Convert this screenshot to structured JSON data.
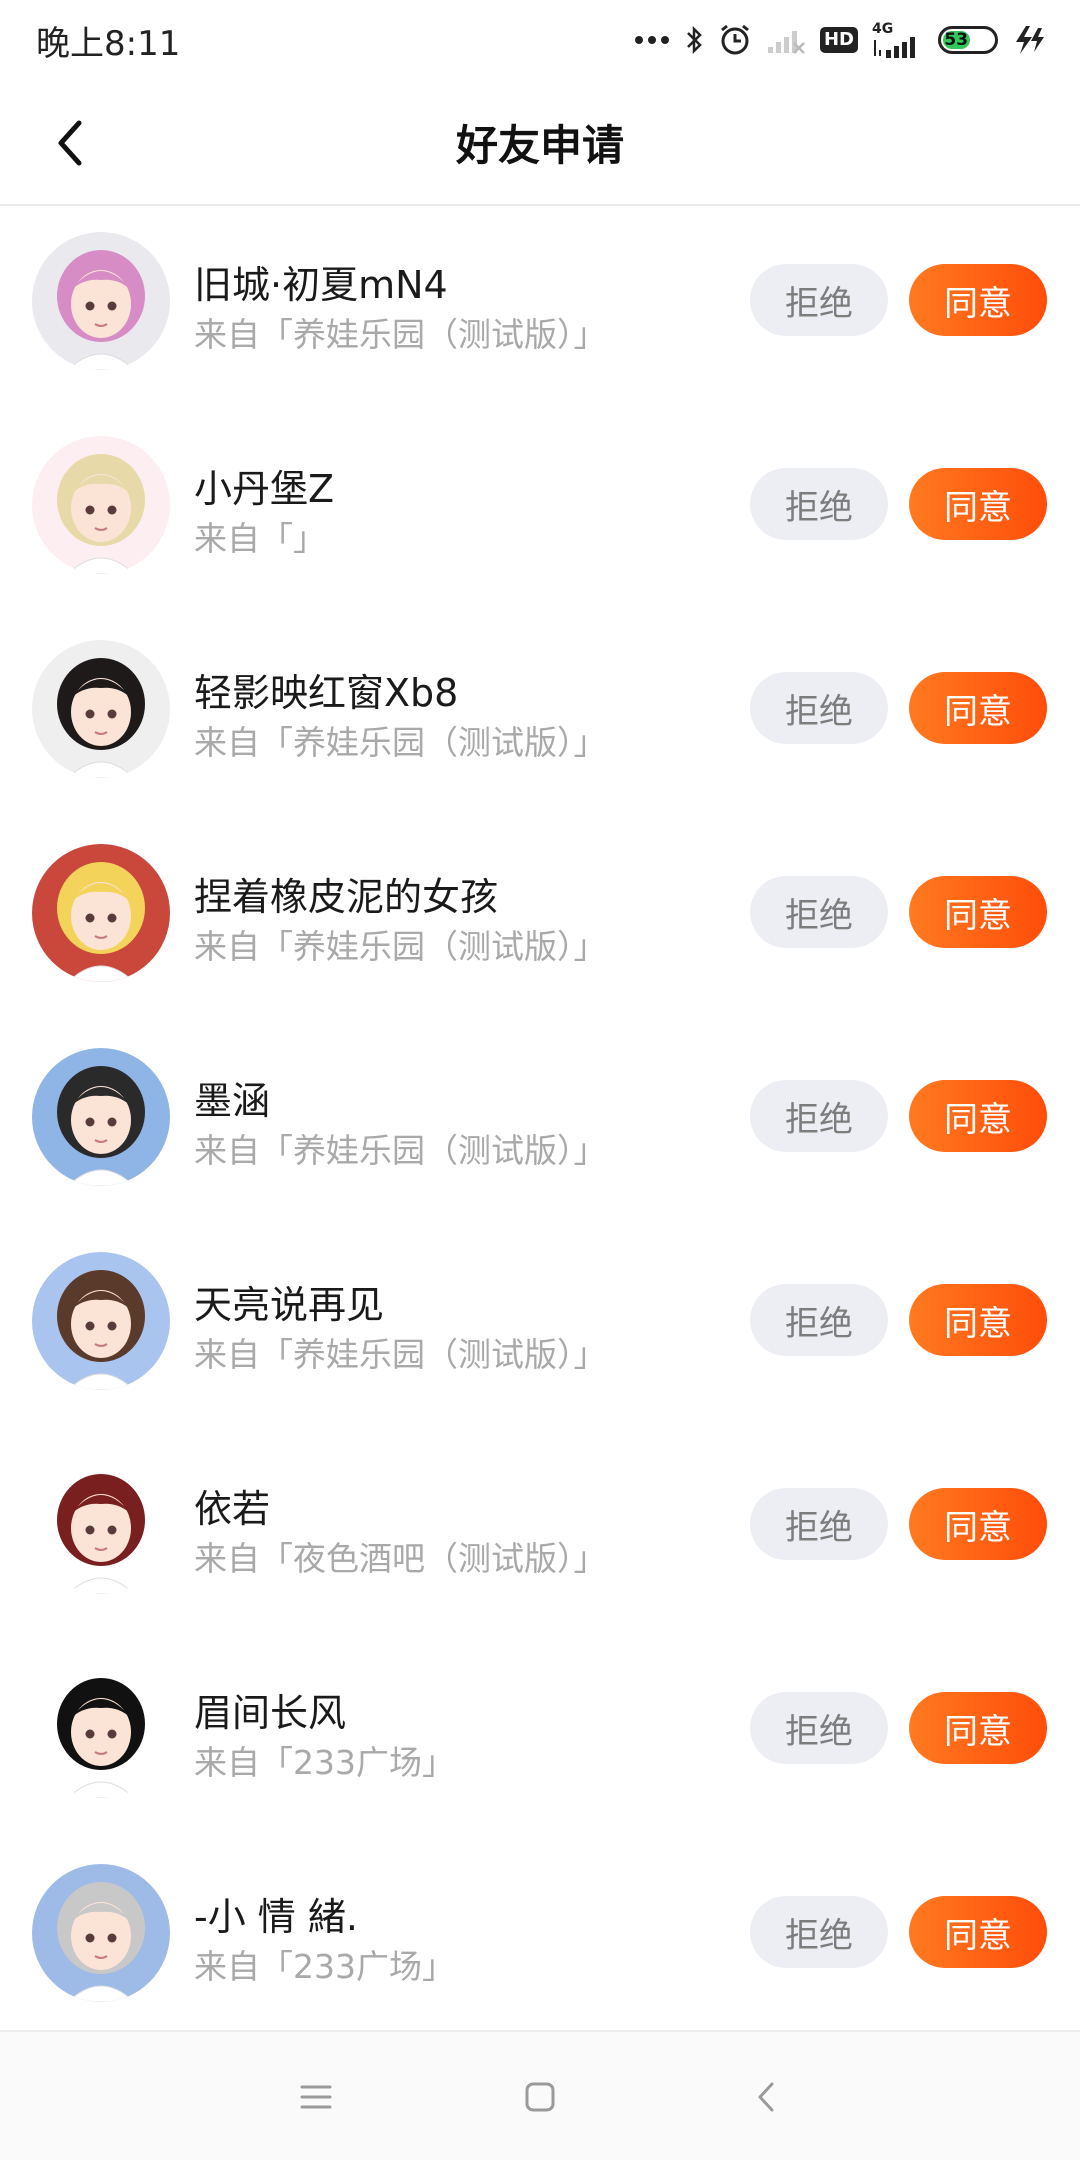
{
  "status_bar": {
    "time": "晚上8:11",
    "network": "4G",
    "hd": "HD",
    "battery": "53",
    "battery_level": 0.53,
    "icons": [
      "more-dots-icon",
      "bluetooth-icon",
      "alarm-icon",
      "no-signal-icon",
      "hd-icon",
      "4g-signal-icon",
      "battery-icon",
      "charging-icon"
    ]
  },
  "header": {
    "title": "好友申请",
    "back_icon": "back-chevron-icon"
  },
  "requests": [
    {
      "name": "旧城·初夏mN4",
      "source": "来自「养娃乐园（测试版）」",
      "reject": "拒绝",
      "accept": "同意",
      "avatar_bg": "#e9e9ee",
      "hair": "#d88cc6"
    },
    {
      "name": "小丹堡Z",
      "source": "来自「」",
      "reject": "拒绝",
      "accept": "同意",
      "avatar_bg": "#fdeef1",
      "hair": "#e8d9a8"
    },
    {
      "name": "轻影映红窗Xb8",
      "source": "来自「养娃乐园（测试版）」",
      "reject": "拒绝",
      "accept": "同意",
      "avatar_bg": "#efefef",
      "hair": "#1e1a1a"
    },
    {
      "name": "捏着橡皮泥的女孩",
      "source": "来自「养娃乐园（测试版）」",
      "reject": "拒绝",
      "accept": "同意",
      "avatar_bg": "#c9473b",
      "hair": "#f4d35a"
    },
    {
      "name": "墨涵",
      "source": "来自「养娃乐园（测试版）」",
      "reject": "拒绝",
      "accept": "同意",
      "avatar_bg": "#8fb5e6",
      "hair": "#2a2a2a"
    },
    {
      "name": "天亮说再见",
      "source": "来自「养娃乐园（测试版）」",
      "reject": "拒绝",
      "accept": "同意",
      "avatar_bg": "#a9c4ef",
      "hair": "#5a3a2a"
    },
    {
      "name": "依若",
      "source": "来自「夜色酒吧（测试版）」",
      "reject": "拒绝",
      "accept": "同意",
      "avatar_bg": "#ffffff",
      "hair": "#7a1f1f"
    },
    {
      "name": "眉间长风",
      "source": "来自「233广场」",
      "reject": "拒绝",
      "accept": "同意",
      "avatar_bg": "#ffffff",
      "hair": "#111111"
    },
    {
      "name": "-小 情 緒.",
      "source": "来自「233广场」",
      "reject": "拒绝",
      "accept": "同意",
      "avatar_bg": "#9ebbe8",
      "hair": "#c8c8c8"
    }
  ],
  "nav_bar": {
    "menu_icon": "menu-icon",
    "home_icon": "home-square-icon",
    "back_icon": "nav-back-icon"
  },
  "colors": {
    "accent": "#ff5a14",
    "reject_bg": "#eceef3",
    "source_text": "#a9a9a9"
  }
}
